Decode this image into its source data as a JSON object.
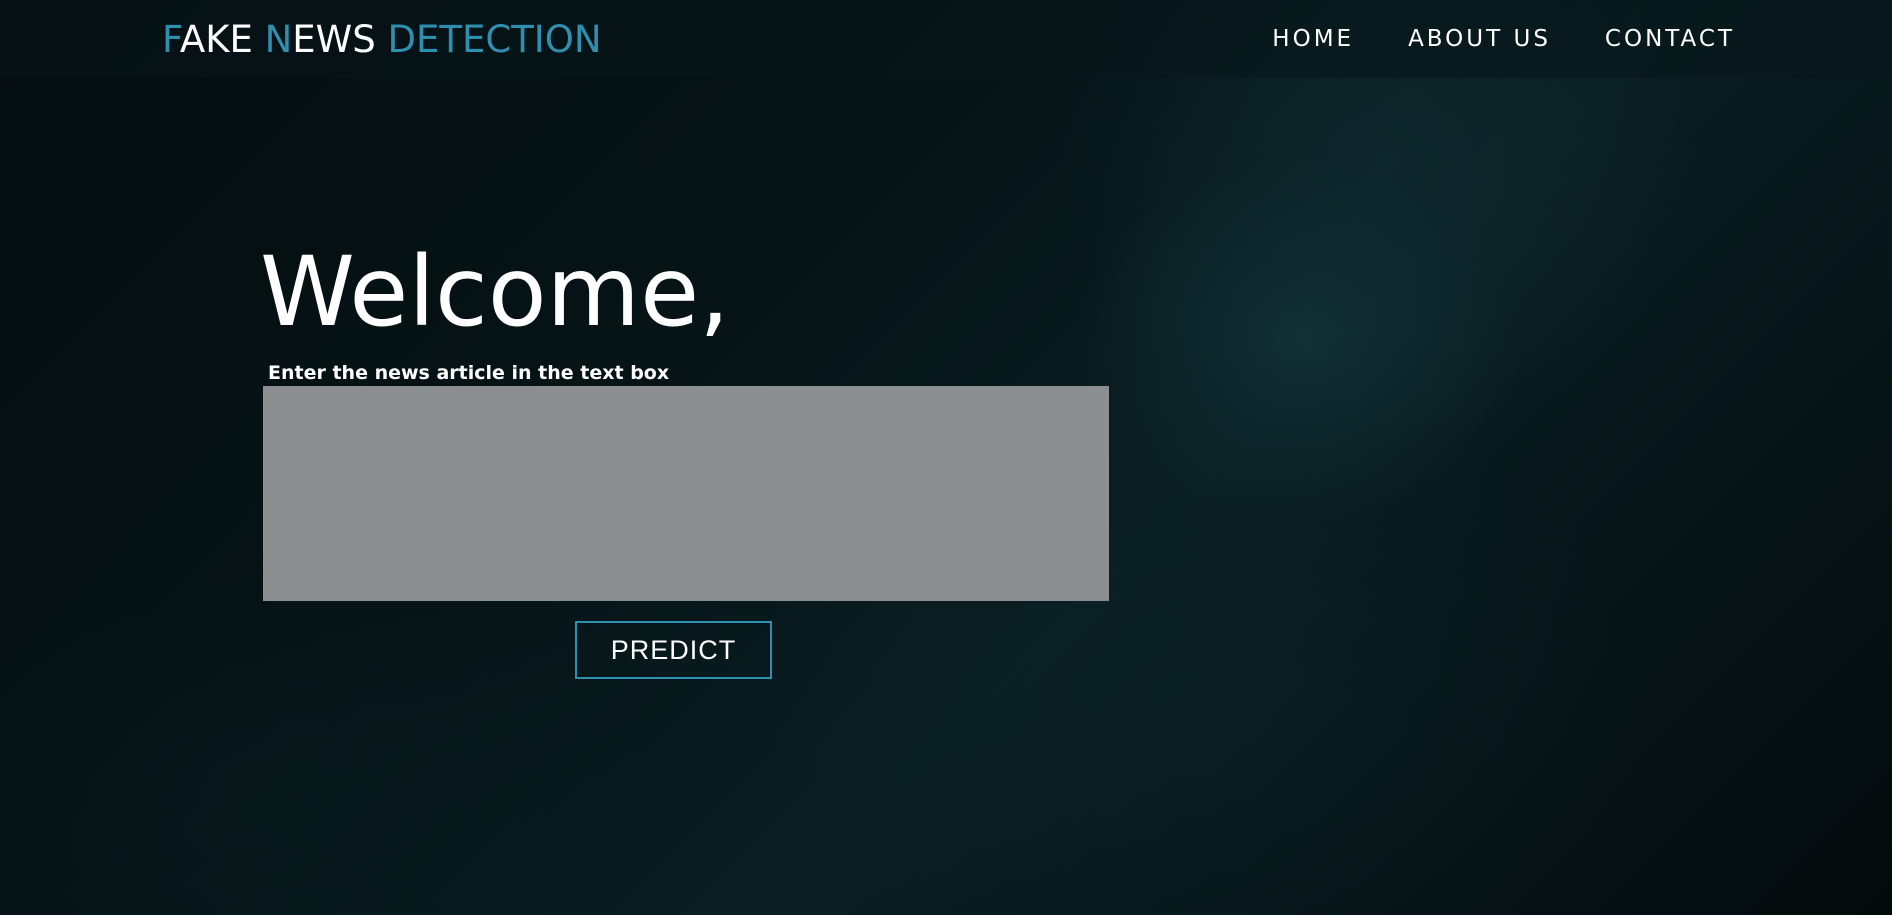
{
  "navbar": {
    "brand": {
      "part1_first": "F",
      "part1_rest": "AKE ",
      "part2_first": "N",
      "part2_rest": "EWS ",
      "part3": "DETECTION"
    },
    "links": [
      {
        "label": "HOME"
      },
      {
        "label": "ABOUT US"
      },
      {
        "label": "CONTACT"
      }
    ]
  },
  "main": {
    "heading": "Welcome,",
    "prompt": "Enter the news article in the text box",
    "article_value": "",
    "predict_label": "PREDICT"
  },
  "colors": {
    "accent": "#2f8fae",
    "textbox": "#8b8f90",
    "background": "#061518"
  }
}
